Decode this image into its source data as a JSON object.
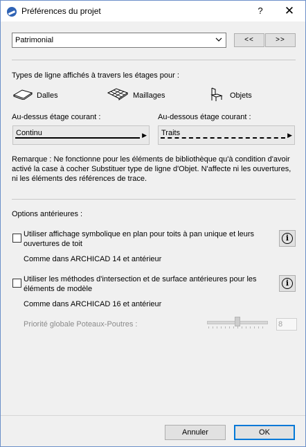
{
  "window": {
    "title": "Préférences du projet",
    "help_label": "?",
    "close_label": "✕"
  },
  "top": {
    "dropdown_value": "Patrimonial",
    "prev_label": "<<",
    "next_label": ">>"
  },
  "linetypes": {
    "heading": "Types de ligne affichés à travers les étages pour :",
    "categories": [
      "Dalles",
      "Maillages",
      "Objets"
    ],
    "above_label": "Au-dessus étage courant :",
    "above_value": "Continu",
    "below_label": "Au-dessous étage courant :",
    "below_value": "Traits",
    "remark": "Remarque : Ne fonctionne pour les éléments de bibliothèque qu'à condition d'avoir activé la case à cocher Substituer type de ligne d'Objet. N'affecte ni les ouvertures, ni les éléments des références de trace."
  },
  "legacy": {
    "heading": "Options antérieures :",
    "option1_label": "Utiliser affichage symbolique en plan pour toits à pan unique et leurs ouvertures de toit",
    "option1_note": "Comme dans ARCHICAD 14 et antérieur",
    "option2_label": "Utiliser les méthodes d'intersection et de surface antérieures pour les éléments de modèle",
    "option2_note": "Comme dans ARCHICAD 16 et antérieur",
    "priority_label": "Priorité globale Poteaux-Poutres :",
    "priority_value": "8",
    "info_glyph": "i"
  },
  "footer": {
    "cancel_label": "Annuler",
    "ok_label": "OK"
  }
}
